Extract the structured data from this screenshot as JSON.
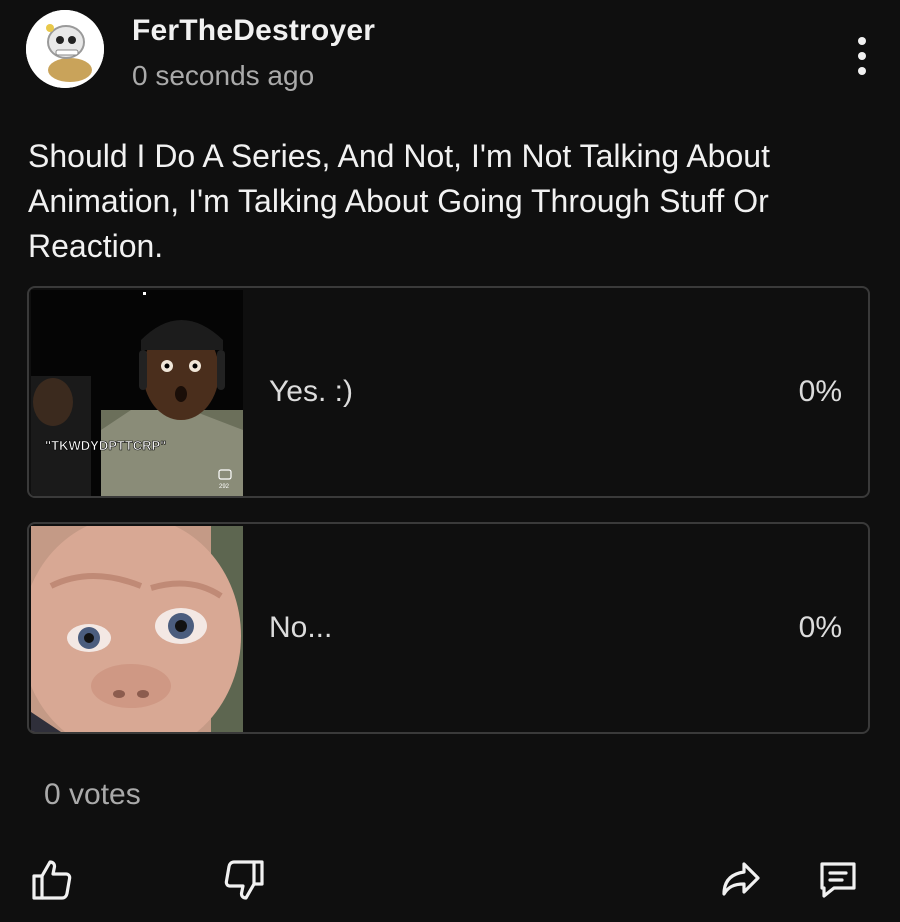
{
  "post": {
    "author": "FerTheDestroyer",
    "time": "0 seconds ago",
    "text": "Should I Do A Series, And Not, I'm Not Talking About Animation, I'm Talking About Going Through Stuff Or Reaction."
  },
  "poll": {
    "options": [
      {
        "label": "Yes. :)",
        "percent": "0%",
        "thumb_caption": "\"TKWDYDPTTCRP\"",
        "thumb_count": "292"
      },
      {
        "label": "No...",
        "percent": "0%"
      }
    ],
    "votes": "0 votes"
  },
  "icons": {
    "more": "more-vert-icon",
    "like": "thumbs-up-icon",
    "dislike": "thumbs-down-icon",
    "share": "share-icon",
    "comment": "comment-icon"
  },
  "colors": {
    "background": "#0f0f0f",
    "text": "#f1f1f1",
    "secondary_text": "#aaaaaa",
    "border": "#3a3a3a"
  }
}
